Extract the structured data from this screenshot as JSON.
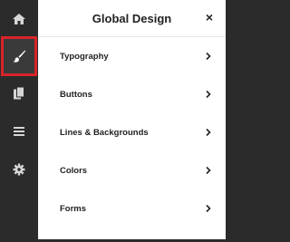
{
  "rail": {
    "items": [
      {
        "name": "home",
        "icon": "home-icon",
        "active": false
      },
      {
        "name": "design",
        "icon": "paintbrush-icon",
        "active": true
      },
      {
        "name": "pages",
        "icon": "pages-icon",
        "active": false
      },
      {
        "name": "menu",
        "icon": "menu-lines-icon",
        "active": false
      },
      {
        "name": "settings",
        "icon": "gear-icon",
        "active": false
      }
    ],
    "active_outline_color": "#d9232a"
  },
  "panel": {
    "title": "Global Design",
    "close_glyph": "×",
    "items": [
      {
        "label": "Typography"
      },
      {
        "label": "Buttons"
      },
      {
        "label": "Lines & Backgrounds"
      },
      {
        "label": "Colors"
      },
      {
        "label": "Forms"
      }
    ]
  }
}
